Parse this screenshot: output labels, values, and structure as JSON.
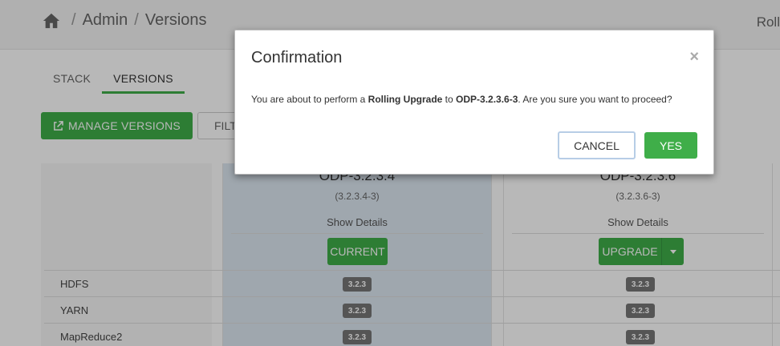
{
  "header": {
    "breadcrumb": [
      "Admin",
      "Versions"
    ],
    "separator": "/",
    "right_text": "Roll"
  },
  "tabs": [
    {
      "label": "STACK",
      "active": false
    },
    {
      "label": "VERSIONS",
      "active": true
    }
  ],
  "toolbar": {
    "manage_label": "MANAGE VERSIONS",
    "filter_label": "FILT"
  },
  "versions": [
    {
      "name": "ODP-3.2.3.4",
      "build": "(3.2.3.4-3)",
      "details": "Show Details",
      "action": "CURRENT"
    },
    {
      "name": "ODP-3.2.3.6",
      "build": "(3.2.3.6-3)",
      "details": "Show Details",
      "action": "UPGRADE"
    }
  ],
  "services": [
    {
      "name": "HDFS",
      "versions": [
        "3.2.3",
        "3.2.3"
      ]
    },
    {
      "name": "YARN",
      "versions": [
        "3.2.3",
        "3.2.3"
      ]
    },
    {
      "name": "MapReduce2",
      "versions": [
        "3.2.3",
        "3.2.3"
      ]
    }
  ],
  "modal": {
    "title": "Confirmation",
    "close": "×",
    "text_before": "You are about to perform a ",
    "upgrade_type": "Rolling Upgrade",
    "text_middle": " to ",
    "target": "ODP-3.2.3.6-3",
    "text_after": ". Are you sure you want to proceed?",
    "cancel_label": "CANCEL",
    "yes_label": "YES"
  },
  "colors": {
    "accent_green": "#3fae49",
    "current_column": "#dde8f2",
    "badge": "#777777"
  }
}
